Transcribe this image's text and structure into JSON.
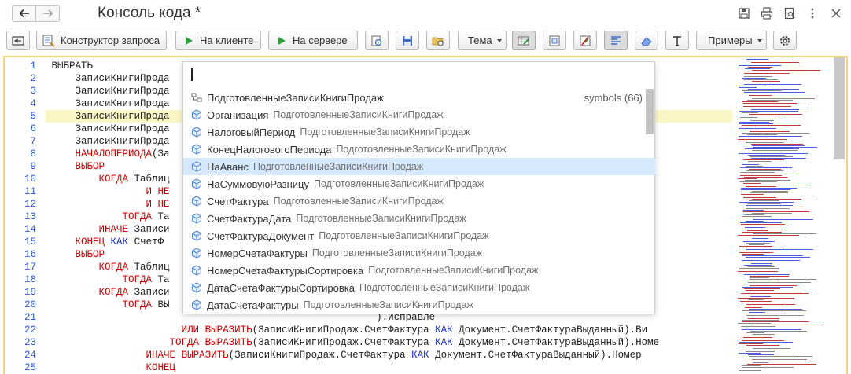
{
  "window": {
    "title": "Консоль кода *"
  },
  "toolbar": {
    "query_builder_label": "Конструктор запроса",
    "run_client_label": "На клиенте",
    "run_server_label": "На сервере",
    "theme_label": "Тема",
    "examples_label": "Примеры"
  },
  "editor": {
    "lines": [
      {
        "n": "1",
        "text": "ВЫБРАТЬ"
      },
      {
        "n": "2",
        "text": "    ЗаписиКнигиПрода"
      },
      {
        "n": "3",
        "text": "    ЗаписиКнигиПрода"
      },
      {
        "n": "4",
        "text": "    ЗаписиКнигиПрода"
      },
      {
        "n": "5",
        "text": "    ЗаписиКнигиПрода"
      },
      {
        "n": "6",
        "text": "    ЗаписиКнигиПрода"
      },
      {
        "n": "7",
        "text": "    ЗаписиКнигиПрода"
      },
      {
        "n": "8",
        "text": "    НАЧАЛОПЕРИОДА(За"
      },
      {
        "n": "9",
        "text": "    ВЫБОР"
      },
      {
        "n": "10",
        "text": "        КОГДА Таблиц"
      },
      {
        "n": "11",
        "text": "                И НЕ"
      },
      {
        "n": "12",
        "text": "                И НЕ"
      },
      {
        "n": "13",
        "text": "            ТОГДА Та"
      },
      {
        "n": "14",
        "text": "        ИНАЧЕ Записи"
      },
      {
        "n": "15",
        "text": "    КОНЕЦ КАК СчетФ"
      },
      {
        "n": "16",
        "text": "    ВЫБОР"
      },
      {
        "n": "17",
        "text": "        КОГДА Таблиц"
      },
      {
        "n": "18",
        "text": "            ТОГДА Та"
      },
      {
        "n": "19",
        "text": "        КОГДА Записи"
      },
      {
        "n": "20",
        "text": "            ТОГДА ВЫ"
      },
      {
        "n": "21",
        "text": "                                                       ).Исправле"
      },
      {
        "n": "22",
        "text": "                      ИЛИ ВЫРАЗИТЬ(ЗаписиКнигиПродаж.СчетФактура КАК Документ.СчетФактураВыданный).Ви"
      },
      {
        "n": "23",
        "text": "                    ТОГДА ВЫРАЗИТЬ(ЗаписиКнигиПродаж.СчетФактура КАК Документ.СчетФактураВыданный).Номе"
      },
      {
        "n": "24",
        "text": "                ИНАЧЕ ВЫРАЗИТЬ(ЗаписиКнигиПродаж.СчетФактура КАК Документ.СчетФактураВыданный).Номер"
      },
      {
        "n": "25",
        "text": "                КОНЕЦ"
      }
    ]
  },
  "autocomplete": {
    "table_item": {
      "name": "ПодготовленныеЗаписиКнигиПродаж",
      "right": "symbols (66)"
    },
    "owner": "ПодготовленныеЗаписиКнигиПродаж",
    "items": [
      {
        "name": "Организация"
      },
      {
        "name": "НалоговыйПериод"
      },
      {
        "name": "КонецНалоговогоПериода"
      },
      {
        "name": "НаАванс"
      },
      {
        "name": "НаСуммовуюРазницу"
      },
      {
        "name": "СчетФактура"
      },
      {
        "name": "СчетФактураДата"
      },
      {
        "name": "СчетФактураДокумент"
      },
      {
        "name": "НомерСчетаФактуры"
      },
      {
        "name": "НомерСчетаФактурыСортировка"
      },
      {
        "name": "ДатаСчетаФактурыСортировка"
      },
      {
        "name": "ДатаСчетаФактуры"
      }
    ]
  },
  "colors": {
    "keyword_red": "#cc0000",
    "keyword_blue": "#1a2fd0",
    "line_number_blue": "#2c5ad6",
    "selected_row": "#d6e8fb",
    "current_line": "#fbf6c6"
  }
}
